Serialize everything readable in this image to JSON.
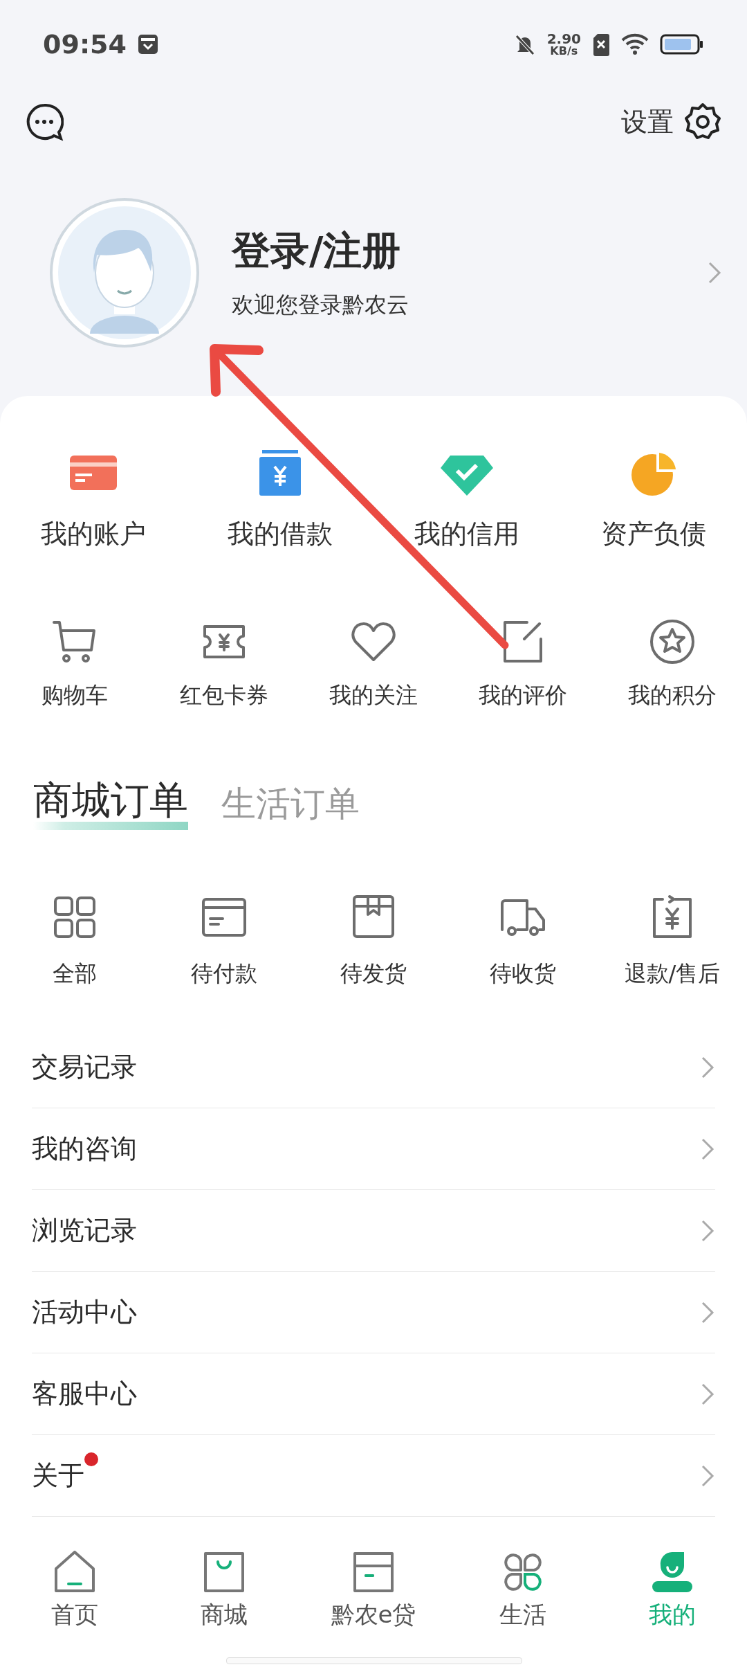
{
  "status_bar": {
    "time": "09:54",
    "net_speed": "2.90",
    "net_unit": "KB/s"
  },
  "header": {
    "settings_label": "设置"
  },
  "profile": {
    "title": "登录/注册",
    "subtitle": "欢迎您登录黔农云"
  },
  "finance": [
    {
      "kind": "account",
      "label": "我的账户"
    },
    {
      "kind": "loan",
      "label": "我的借款"
    },
    {
      "kind": "credit",
      "label": "我的信用"
    },
    {
      "kind": "assets",
      "label": "资产负债"
    }
  ],
  "shortcuts": [
    {
      "kind": "cart",
      "label": "购物车"
    },
    {
      "kind": "coupon",
      "label": "红包卡券"
    },
    {
      "kind": "heart",
      "label": "我的关注"
    },
    {
      "kind": "edit",
      "label": "我的评价"
    },
    {
      "kind": "star",
      "label": "我的积分"
    }
  ],
  "order_tabs": [
    {
      "label": "商城订单",
      "selected": true
    },
    {
      "label": "生活订单",
      "selected": false
    }
  ],
  "orders": [
    {
      "kind": "grid",
      "label": "全部"
    },
    {
      "kind": "card",
      "label": "待付款"
    },
    {
      "kind": "box",
      "label": "待发货"
    },
    {
      "kind": "truck",
      "label": "待收货"
    },
    {
      "kind": "refund",
      "label": "退款/售后"
    }
  ],
  "menu": [
    {
      "label": "交易记录",
      "badge": false
    },
    {
      "label": "我的咨询",
      "badge": false
    },
    {
      "label": "浏览记录",
      "badge": false
    },
    {
      "label": "活动中心",
      "badge": false
    },
    {
      "label": "客服中心",
      "badge": false
    },
    {
      "label": "关于",
      "badge": true
    }
  ],
  "nav": [
    {
      "kind": "home",
      "label": "首页",
      "selected": false
    },
    {
      "kind": "shop",
      "label": "商城",
      "selected": false
    },
    {
      "kind": "loan",
      "label": "黔农e贷",
      "selected": false
    },
    {
      "kind": "life",
      "label": "生活",
      "selected": false
    },
    {
      "kind": "me",
      "label": "我的",
      "selected": true
    }
  ]
}
